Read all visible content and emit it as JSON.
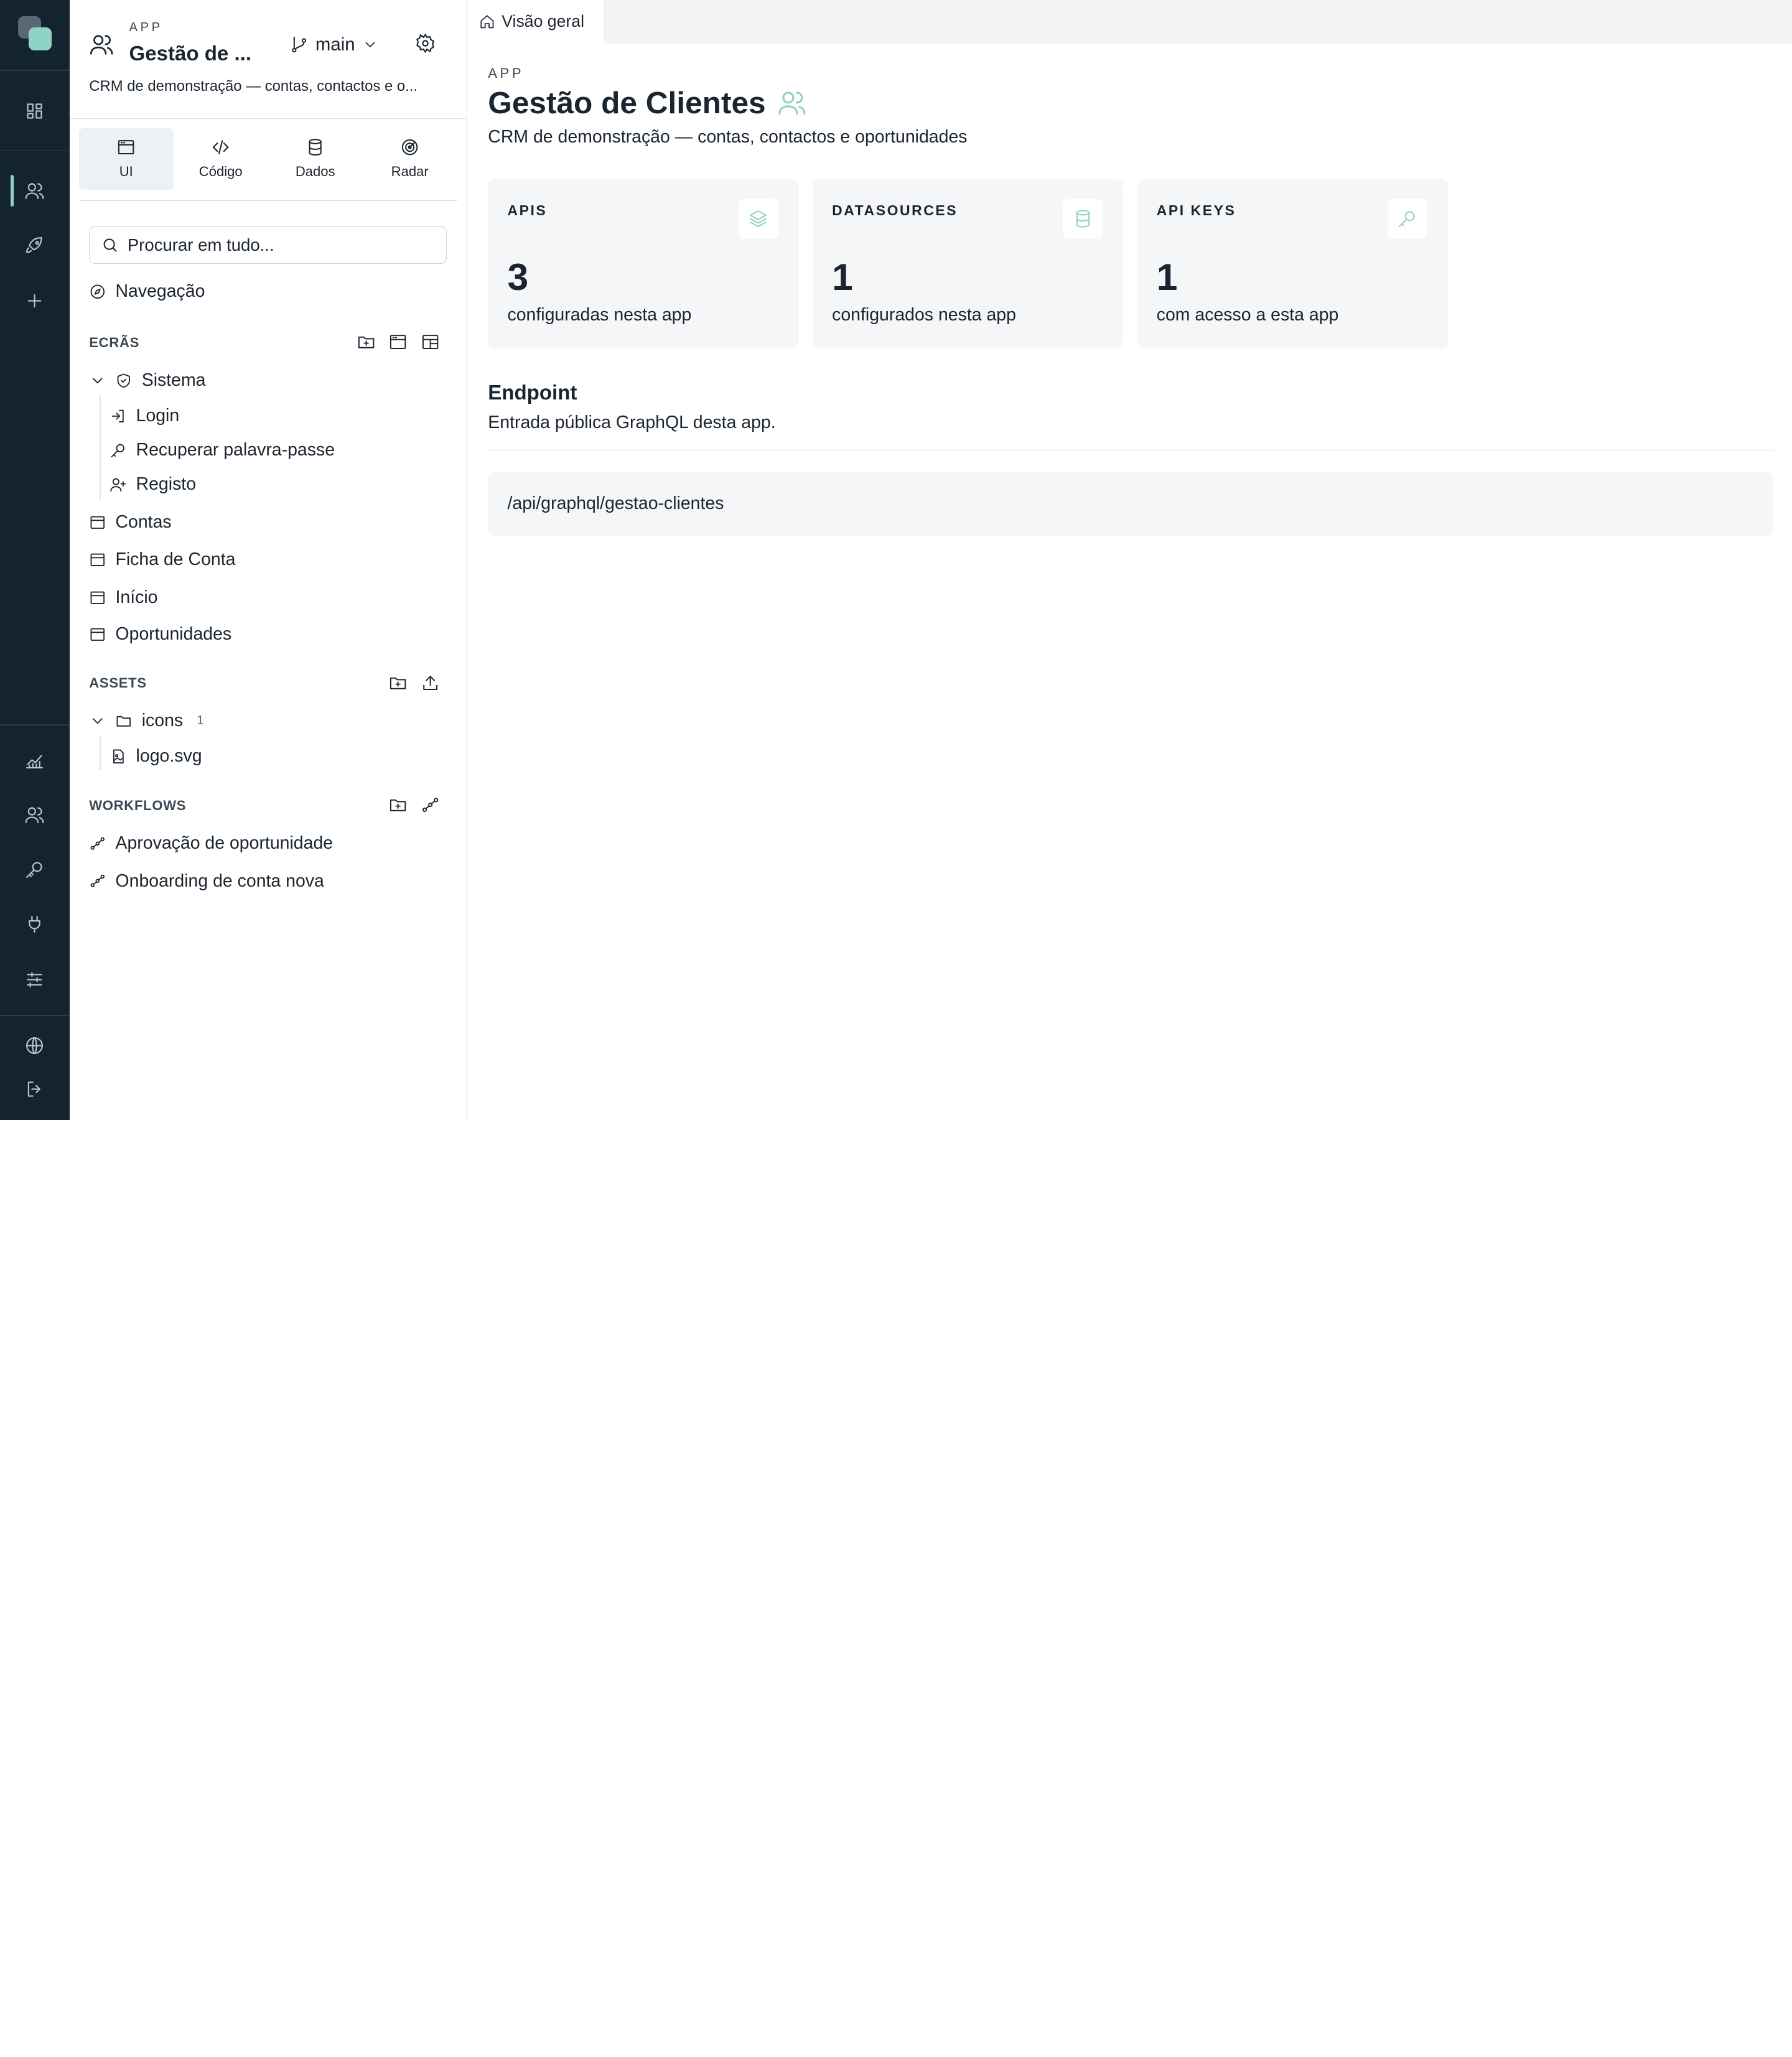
{
  "sidebar_header": {
    "kicker": "APP",
    "app_name": "Gestão de ...",
    "branch": "main",
    "description": "CRM de demonstração — contas, contactos e o..."
  },
  "tabs": [
    {
      "label": "UI",
      "icon": "window-icon",
      "active": true
    },
    {
      "label": "Código",
      "icon": "code-icon",
      "active": false
    },
    {
      "label": "Dados",
      "icon": "database-icon",
      "active": false
    },
    {
      "label": "Radar",
      "icon": "radar-icon",
      "active": false
    }
  ],
  "search": {
    "placeholder": "Procurar em tudo..."
  },
  "navigation_label": "Navegação",
  "screens": {
    "title": "ECRÃS",
    "group": "Sistema",
    "group_children": [
      "Login",
      "Recuperar palavra-passe",
      "Registo"
    ],
    "items": [
      "Contas",
      "Ficha de Conta",
      "Início",
      "Oportunidades"
    ]
  },
  "assets": {
    "title": "ASSETS",
    "folder": "icons",
    "folder_count": "1",
    "file": "logo.svg"
  },
  "workflows": {
    "title": "WORKFLOWS",
    "items": [
      "Aprovação de oportunidade",
      "Onboarding de conta nova"
    ]
  },
  "main": {
    "tab_label": "Visão geral",
    "kicker": "APP",
    "title": "Gestão de Clientes",
    "subtitle": "CRM de demonstração — contas, contactos e oportunidades",
    "cards": [
      {
        "label": "APIS",
        "value": "3",
        "caption": "configuradas nesta app",
        "icon": "layers-icon"
      },
      {
        "label": "DATASOURCES",
        "value": "1",
        "caption": "configurados nesta app",
        "icon": "database-icon"
      },
      {
        "label": "API KEYS",
        "value": "1",
        "caption": "com acesso a esta app",
        "icon": "key-icon"
      }
    ],
    "endpoint": {
      "title": "Endpoint",
      "description": "Entrada pública GraphQL desta app.",
      "path": "/api/graphql/gestao-clientes"
    }
  },
  "colors": {
    "rail": "#13232f",
    "accent": "#8fd3c4",
    "card": "#f4f6f8"
  }
}
